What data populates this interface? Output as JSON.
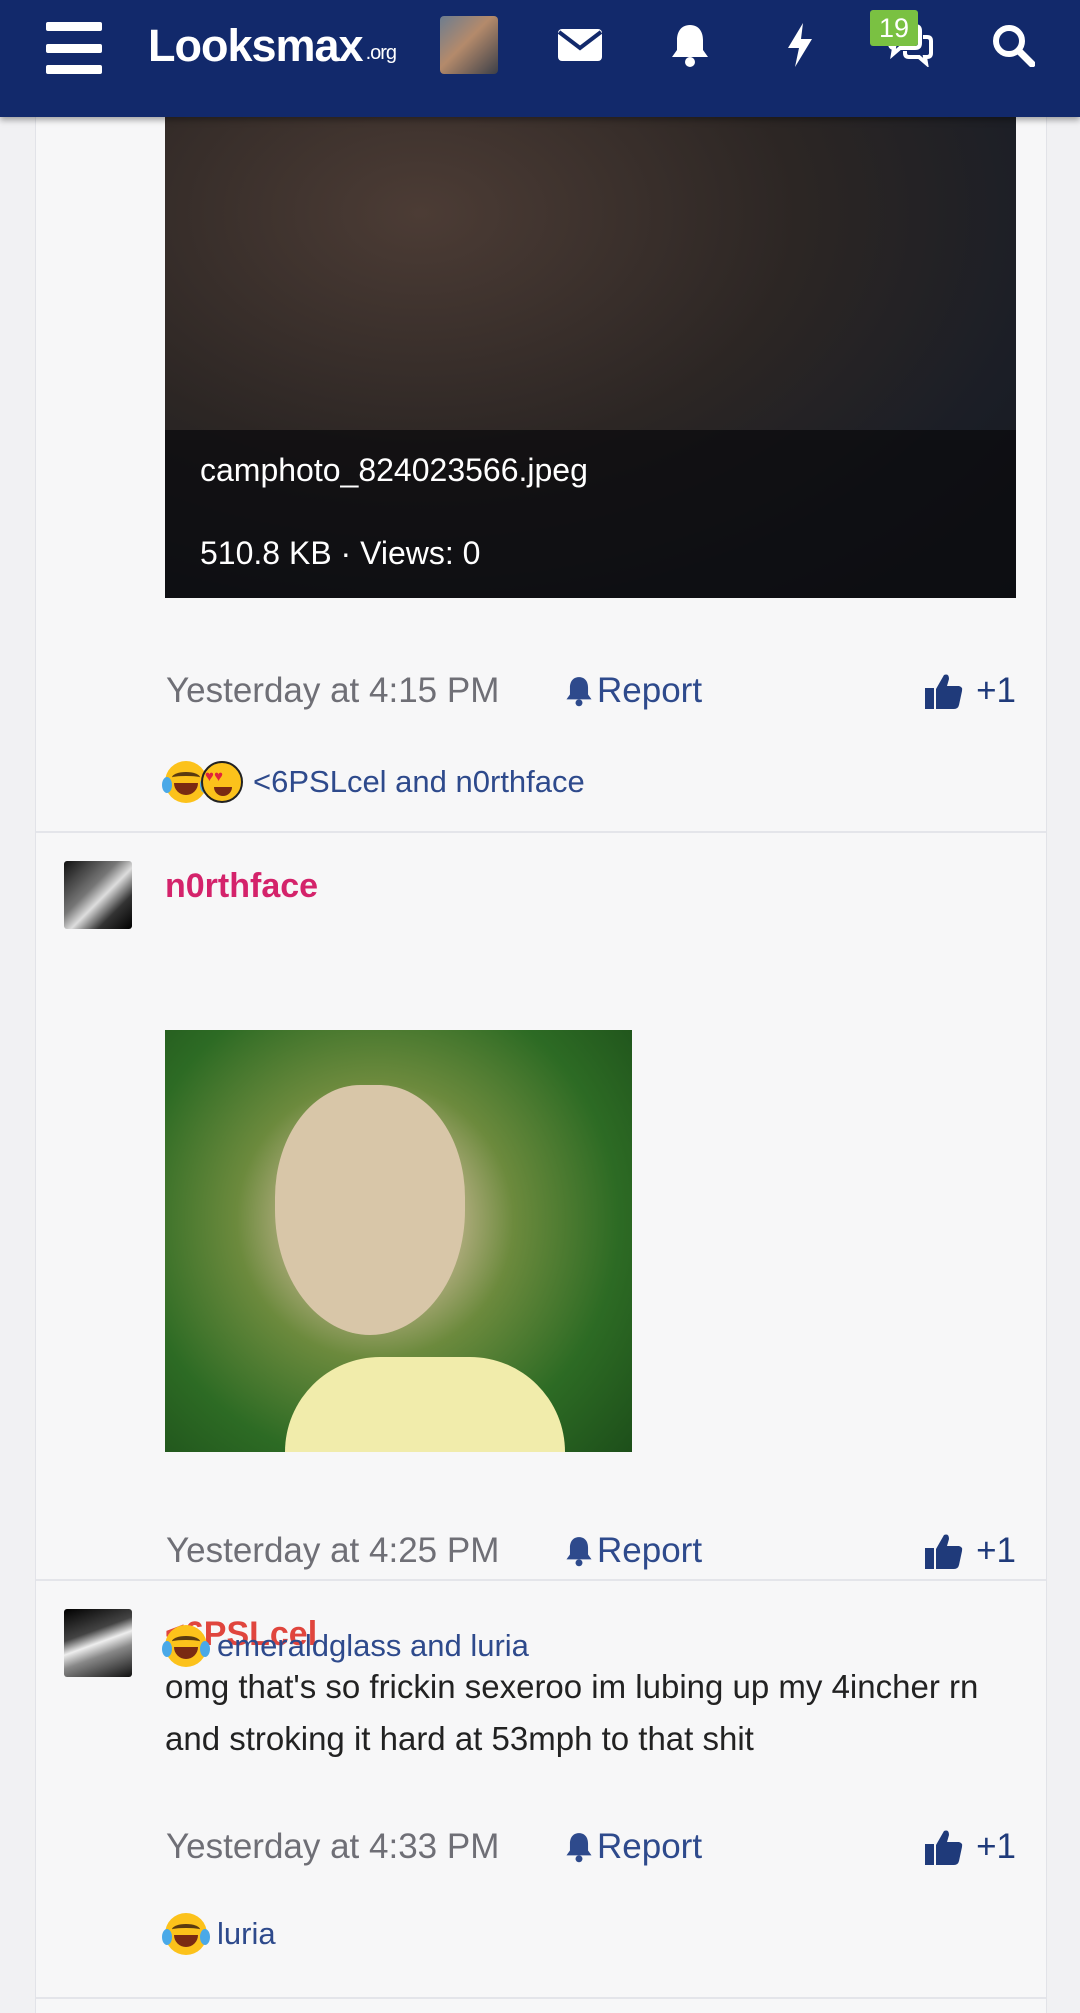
{
  "header": {
    "logo_text": "Looksmax",
    "logo_suffix": ".org",
    "alerts_badge": "19",
    "icons": [
      "menu-icon",
      "envelope-icon",
      "bell-icon",
      "bolt-icon",
      "chat-icon",
      "search-icon"
    ],
    "brand_color": "#12296b",
    "badge_color": "#7ac142"
  },
  "posts": [
    {
      "attachment": {
        "filename": "camphoto_824023566.jpeg",
        "meta": "510.8 KB · Views: 0"
      },
      "timestamp": "Yesterday at 4:15 PM",
      "report_label": "Report",
      "like_label": "+1",
      "reactions_text": "<6PSLcel and n0rthface",
      "reaction_icons": [
        "joy-emoji-icon",
        "heart-eyes-emoji-icon"
      ]
    },
    {
      "author": "n0rthface",
      "author_color": "#d4236b",
      "timestamp": "Yesterday at 4:25 PM",
      "report_label": "Report",
      "like_label": "+1",
      "reactions_text": "emeraldglass and luria",
      "reaction_icons": [
        "joy-emoji-icon"
      ]
    },
    {
      "author": "<6PSLcel",
      "author_color": "#e0453d",
      "message": "omg that's so frickin sexeroo im lubing up my 4incher rn and stroking it hard at 53mph to that shit",
      "timestamp": "Yesterday at 4:33 PM",
      "report_label": "Report",
      "like_label": "+1",
      "reactions_text": "luria",
      "reaction_icons": [
        "joy-emoji-icon"
      ]
    }
  ]
}
